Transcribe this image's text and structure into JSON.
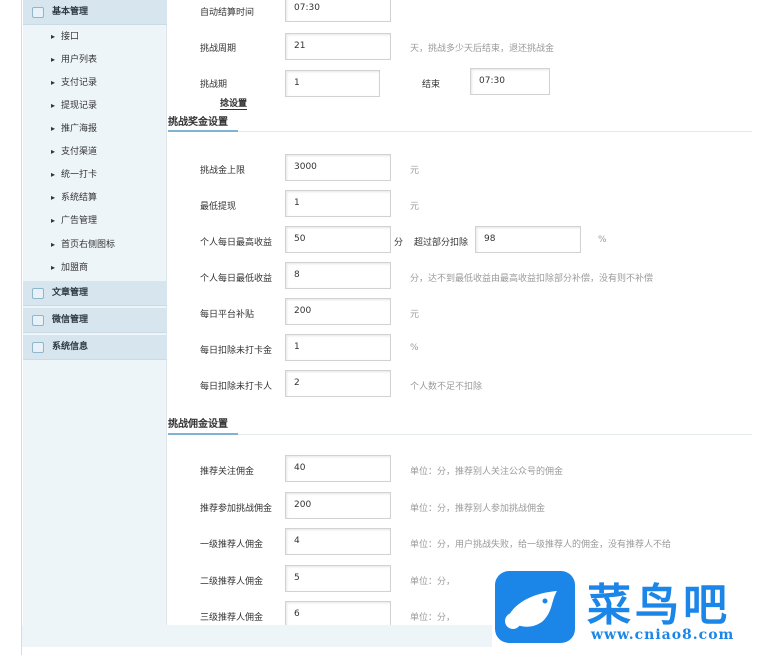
{
  "sidebar": {
    "sections": [
      {
        "label": "基本管理"
      },
      {
        "label": "文章管理"
      },
      {
        "label": "微信管理"
      },
      {
        "label": "系统信息"
      }
    ],
    "items": [
      "接口",
      "用户列表",
      "支付记录",
      "提现记录",
      "推广海报",
      "支付渠道",
      "统一打卡",
      "系统结算",
      "广告管理",
      "首页右侧图标",
      "加盟商"
    ]
  },
  "top": {
    "auto_settle_label": "自动结算时间",
    "auto_settle_value": "07:30",
    "cycle_label": "挑战周期",
    "cycle_value": "21",
    "cycle_note": "天，挑战多少天后结束，退还挑战金",
    "period_label": "挑战期",
    "period_value": "1",
    "end_label": "结束",
    "end_value": "07:30",
    "partial_title": "捻设置"
  },
  "bonus": {
    "title": "挑战奖金设置",
    "rows": [
      {
        "label": "挑战金上限",
        "value": "3000",
        "note": "元"
      },
      {
        "label": "最低提现",
        "value": "1",
        "note": "元"
      },
      {
        "label": "个人每日最高收益",
        "value": "50",
        "note": "%"
      },
      {
        "label": "个人每日最低收益",
        "value": "8",
        "note": "分，达不到最低收益由最高收益扣除部分补偿，没有则不补偿"
      },
      {
        "label": "每日平台补贴",
        "value": "200",
        "note": "元"
      },
      {
        "label": "每日扣除未打卡金",
        "value": "1",
        "note": "%"
      },
      {
        "label": "每日扣除未打卡人",
        "value": "2",
        "note": "个人数不足不扣除"
      }
    ],
    "unit_fen": "分",
    "excess_label": "超过部分扣除",
    "excess_value": "98"
  },
  "commission": {
    "title": "挑战佣金设置",
    "rows": [
      {
        "label": "推荐关注佣金",
        "value": "40",
        "note": "单位：分，推荐别人关注公众号的佣金"
      },
      {
        "label": "推荐参加挑战佣金",
        "value": "200",
        "note": "单位：分，推荐别人参加挑战佣金"
      },
      {
        "label": "一级推荐人佣金",
        "value": "4",
        "note": "单位：分，用户挑战失败，给一级推荐人的佣金，没有推荐人不给"
      },
      {
        "label": "二级推荐人佣金",
        "value": "5",
        "note": "单位：分，"
      },
      {
        "label": "三级推荐人佣金",
        "value": "6",
        "note": "单位：分，"
      }
    ]
  },
  "watermark": {
    "brand": "菜鸟吧",
    "url": "www.cniao8.com"
  }
}
